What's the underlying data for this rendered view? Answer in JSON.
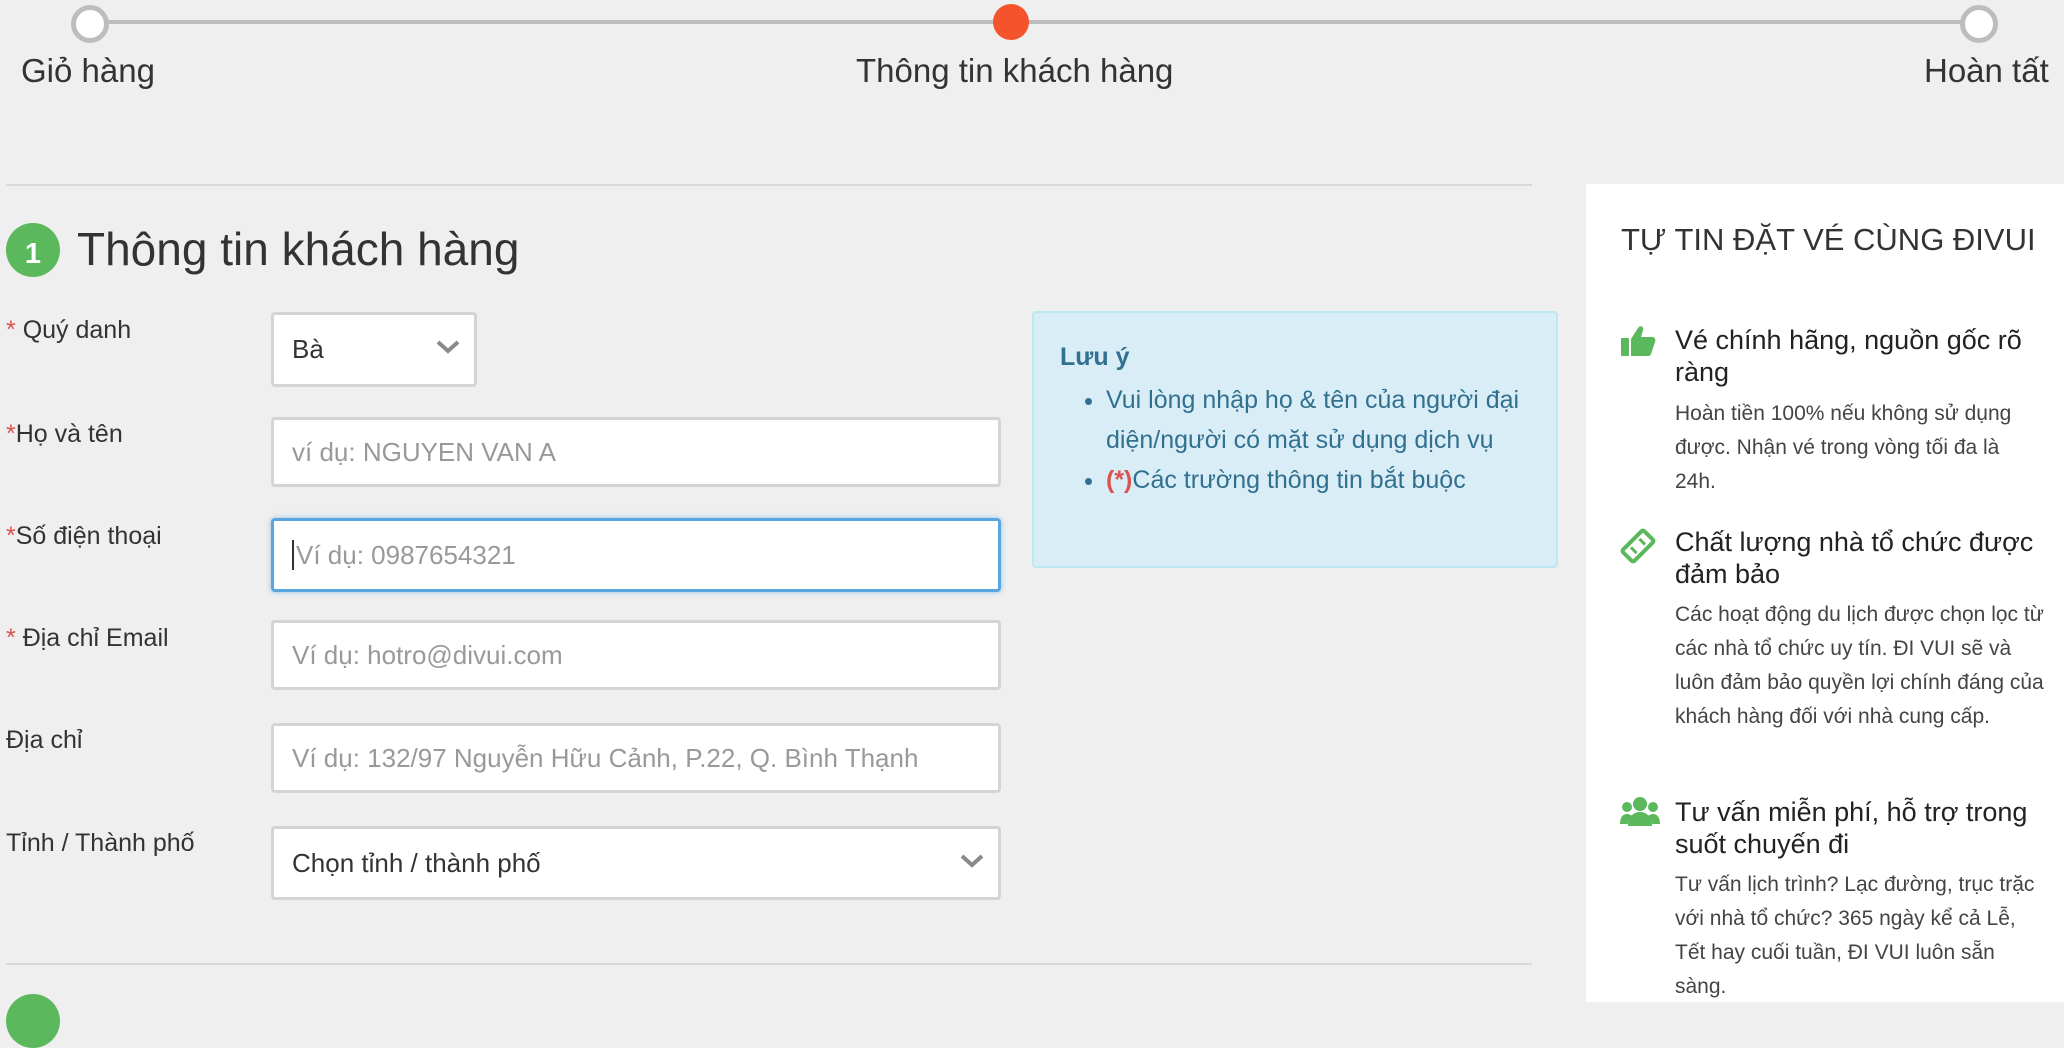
{
  "steps": [
    {
      "label": "Giỏ hàng",
      "state": "done"
    },
    {
      "label": "Thông tin khách hàng",
      "state": "active"
    },
    {
      "label": "Hoàn tất",
      "state": "pending"
    }
  ],
  "colors": {
    "accent": "#f4532b",
    "green": "#5cb85c",
    "required": "#d9534f",
    "focus": "#59a5df",
    "info_text": "#31708f"
  },
  "section": {
    "number": "1",
    "title": "Thông tin khách hàng"
  },
  "form": {
    "salutation": {
      "req": "*",
      "label": "Quý danh",
      "value": "Bà"
    },
    "fullname": {
      "req": "*",
      "label": "Họ và tên",
      "placeholder": "ví dụ: NGUYEN VAN A"
    },
    "phone": {
      "req": "*",
      "label": "Số điện thoại",
      "placeholder": "Ví dụ: 0987654321"
    },
    "email": {
      "req": "*",
      "label": "Địa chỉ Email",
      "placeholder": "Ví dụ: hotro@divui.com"
    },
    "address": {
      "label": "Địa chỉ",
      "placeholder": "Ví dụ: 132/97 Nguyễn Hữu Cảnh, P.22, Q. Bình Thạnh"
    },
    "city": {
      "label": "Tỉnh / Thành phố",
      "value": "Chọn tỉnh / thành phố"
    }
  },
  "note": {
    "title": "Lưu ý",
    "items": [
      "Vui lòng nhập họ & tên của người đại diện/người có mặt sử dụng dịch vụ"
    ],
    "required_marker": "(*)",
    "required_text": "Các trường thông tin bắt buộc"
  },
  "sidebar": {
    "title": "TỰ TIN ĐẶT VÉ CÙNG ĐIVUI",
    "features": [
      {
        "icon": "thumbs-up-icon",
        "title": "Vé chính hãng, nguồn gốc rõ ràng",
        "desc": "Hoàn tiền 100% nếu không sử dụng được. Nhận vé trong vòng tối đa là 24h."
      },
      {
        "icon": "ticket-icon",
        "title": "Chất lượng nhà tổ chức được đảm bảo",
        "desc": "Các hoạt động du lịch được chọn lọc từ các nhà tổ chức uy tín. ĐI VUI sẽ và luôn đảm bảo quyền lợi chính đáng của khách hàng đối với nhà cung cấp."
      },
      {
        "icon": "group-icon",
        "title": "Tư vấn miễn phí, hỗ trợ trong suốt chuyến đi",
        "desc": "Tư vấn lịch trình? Lạc đường, trục trặc với nhà tổ chức? 365 ngày kể cả Lễ, Tết hay cuối tuần, ĐI VUI luôn sẵn sàng."
      }
    ]
  }
}
